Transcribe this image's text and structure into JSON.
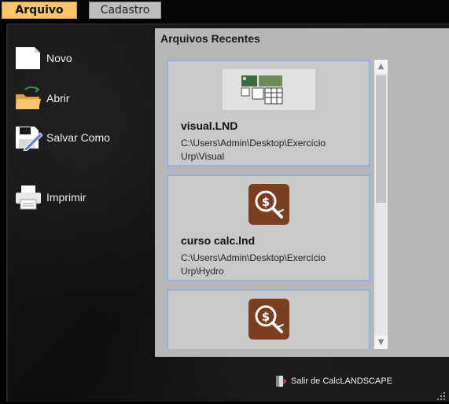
{
  "tabs": {
    "arquivo": "Arquivo",
    "cadastro": "Cadastro"
  },
  "commands": {
    "novo": "Novo",
    "abrir": "Abrir",
    "salvar_como": "Salvar Como",
    "imprimir": "Imprimir"
  },
  "recent": {
    "title": "Arquivos Recentes",
    "items": [
      {
        "name": "visual.LND",
        "path": "C:\\Users\\Admin\\Desktop\\Exercício Urp\\Visual",
        "thumb": "landscape-preview"
      },
      {
        "name": "curso calc.lnd",
        "path": "C:\\Users\\Admin\\Desktop\\Exercício Urp\\Hydro",
        "thumb": "calc-icon"
      },
      {
        "name": "",
        "path": "",
        "thumb": "calc-icon"
      }
    ]
  },
  "exit_label": "Salir de CalcLANDSCAPE",
  "colors": {
    "active_tab": "#f7c56b",
    "card_border": "#8db2e8",
    "calc_icon": "#7a3f1f"
  }
}
